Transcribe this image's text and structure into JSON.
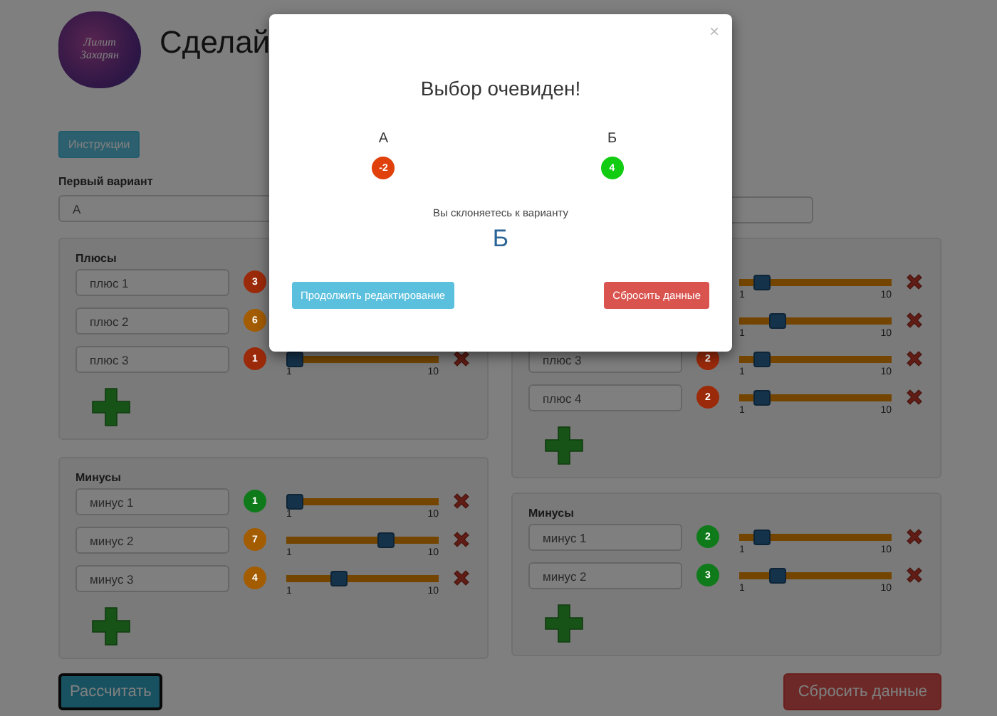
{
  "header": {
    "logo_text": "Лилит Захарян",
    "title": "Сделай"
  },
  "instructions_button": "Инструкции",
  "first_variant": {
    "label": "Первый вариант",
    "value": "А"
  },
  "columns": [
    {
      "panels": [
        {
          "heading": "Плюсы",
          "rows": [
            {
              "name": "плюс 1",
              "score": "3",
              "color": "#9b2a0a"
            },
            {
              "name": "плюс 2",
              "score": "6",
              "color": "#a35c00"
            },
            {
              "name": "плюс 3",
              "score": "1",
              "color": "#9b2a0a",
              "level": 0,
              "min_label": "1",
              "max_label": "10"
            }
          ]
        },
        {
          "heading": "Минусы",
          "rows": [
            {
              "name": "минус 1",
              "score": "1",
              "color": "#0f7a1a",
              "level": 0,
              "min_label": "1",
              "max_label": "10"
            },
            {
              "name": "минус 2",
              "score": "7",
              "color": "#a35c00",
              "level": 0.67,
              "min_label": "1",
              "max_label": "10"
            },
            {
              "name": "минус 3",
              "score": "4",
              "color": "#a35c00",
              "level": 0.33,
              "min_label": "1",
              "max_label": "10"
            }
          ]
        }
      ]
    },
    {
      "panels": [
        {
          "rows": [
            {
              "level": 0.11,
              "min_label": "1",
              "max_label": "10"
            },
            {
              "level": 0.22,
              "min_label": "1",
              "max_label": "10"
            },
            {
              "name": "плюс 3",
              "score": "2",
              "color": "#9b2a0a",
              "level": 0.11,
              "min_label": "1",
              "max_label": "10"
            },
            {
              "name": "плюс 4",
              "score": "2",
              "color": "#9b2a0a",
              "level": 0.11,
              "min_label": "1",
              "max_label": "10"
            }
          ]
        },
        {
          "heading": "Минусы",
          "rows": [
            {
              "name": "минус 1",
              "score": "2",
              "color": "#0f7a1a",
              "level": 0.11,
              "min_label": "1",
              "max_label": "10"
            },
            {
              "name": "минус 2",
              "score": "3",
              "color": "#0f7a1a",
              "level": 0.22,
              "min_label": "1",
              "max_label": "10"
            }
          ]
        }
      ]
    }
  ],
  "calculate_button": "Рассчитать",
  "reset_button": "Сбросить данные",
  "modal": {
    "close": "×",
    "title": "Выбор очевиден!",
    "options": [
      {
        "label": "А",
        "score": "-2",
        "color": "#e0400a"
      },
      {
        "label": "Б",
        "score": "4",
        "color": "#11cc11"
      }
    ],
    "lean_text": "Вы склоняетесь к варианту",
    "winner": "Б",
    "buttons": [
      {
        "label": "Продолжить редактирование",
        "kind": "info"
      },
      {
        "label": "Сбросить данные",
        "kind": "danger"
      }
    ]
  }
}
